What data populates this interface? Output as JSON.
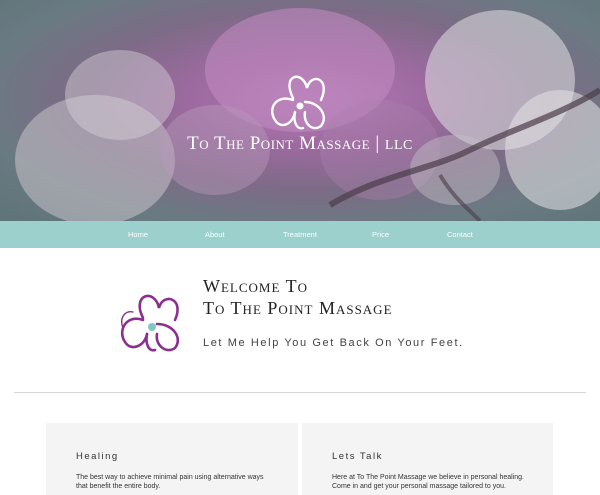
{
  "hero": {
    "title": "To The Point Massage",
    "separator": "|",
    "suffix": "LLC"
  },
  "nav": {
    "items": [
      {
        "label": "Home"
      },
      {
        "label": "About"
      },
      {
        "label": "Treatment"
      },
      {
        "label": "Price"
      },
      {
        "label": "Contact"
      }
    ]
  },
  "welcome": {
    "line1": "Welcome To",
    "line2": "To The Point Massage",
    "subtitle": "Let Me Help You Get Back On Your Feet."
  },
  "cards": [
    {
      "heading": "Healing",
      "body": "The best way to achieve minimal pain using alternative ways that benefit the entire body."
    },
    {
      "heading": "Lets Talk",
      "body": "Here at To The Point Massage we believe in personal healing. Come in and get your personal massage tailored to you."
    }
  ],
  "colors": {
    "nav_bg": "#9bd0cd",
    "brand_purple": "#8a2f8f",
    "accent_teal": "#7fc9c4"
  },
  "icons": {
    "hero_logo": "orchid-logo-icon",
    "welcome_logo": "orchid-logo-icon"
  }
}
